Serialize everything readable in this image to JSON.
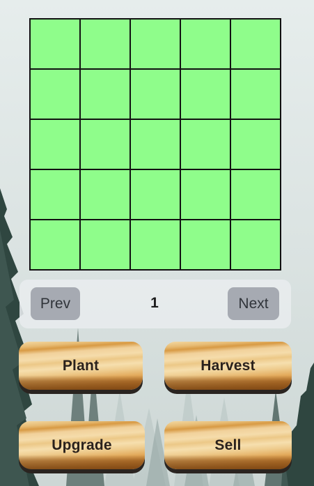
{
  "farm": {
    "rows": 5,
    "cols": 5,
    "plot_color": "#8ffd8b",
    "plot_state": "empty"
  },
  "pager": {
    "prev_label": "Prev",
    "page": "1",
    "next_label": "Next"
  },
  "actions": {
    "plant_label": "Plant",
    "harvest_label": "Harvest",
    "upgrade_label": "Upgrade",
    "sell_label": "Sell"
  },
  "theme": {
    "background": "misty-pine-forest",
    "button_style": "wood",
    "pager_button_color": "#a6aab2"
  }
}
